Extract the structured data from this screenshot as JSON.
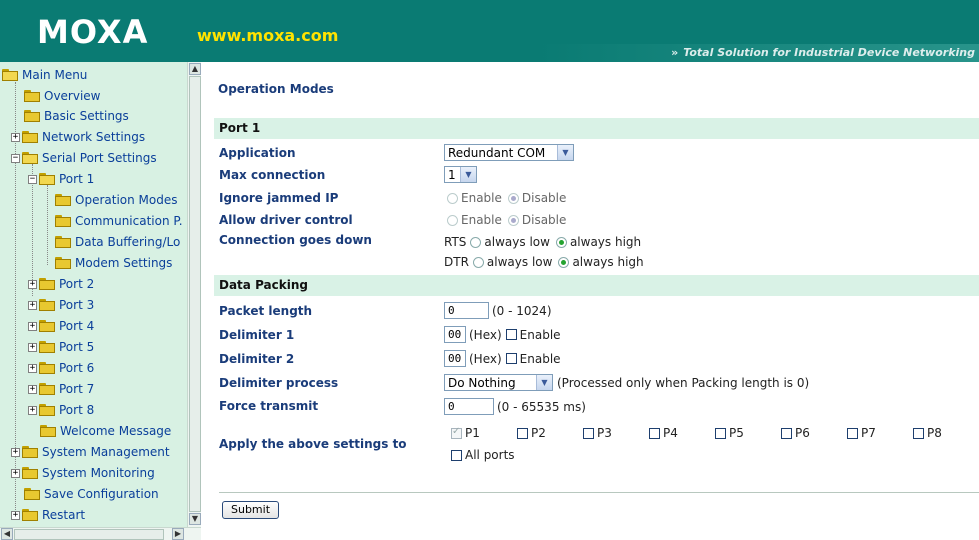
{
  "header": {
    "logo": "MOXA",
    "url": "www.moxa.com",
    "tagline": "Total Solution for Industrial Device Networking"
  },
  "sidebar": {
    "items": [
      {
        "label": "Main Menu"
      },
      {
        "label": "Overview"
      },
      {
        "label": "Basic Settings"
      },
      {
        "label": "Network Settings"
      },
      {
        "label": "Serial Port Settings"
      },
      {
        "label": "Port 1"
      },
      {
        "label": "Operation Modes"
      },
      {
        "label": "Communication P."
      },
      {
        "label": "Data Buffering/Lo"
      },
      {
        "label": "Modem Settings"
      },
      {
        "label": "Port 2"
      },
      {
        "label": "Port 3"
      },
      {
        "label": "Port 4"
      },
      {
        "label": "Port 5"
      },
      {
        "label": "Port 6"
      },
      {
        "label": "Port 7"
      },
      {
        "label": "Port 8"
      },
      {
        "label": "Welcome Message"
      },
      {
        "label": "System Management"
      },
      {
        "label": "System Monitoring"
      },
      {
        "label": "Save Configuration"
      },
      {
        "label": "Restart"
      }
    ]
  },
  "main": {
    "title": "Operation Modes",
    "port_section": "Port 1",
    "application": {
      "label": "Application",
      "value": "Redundant COM"
    },
    "max_connection": {
      "label": "Max connection",
      "value": "1"
    },
    "ignore_jammed": {
      "label": "Ignore jammed IP",
      "enable": "Enable",
      "disable": "Disable",
      "selected": "Disable"
    },
    "allow_driver": {
      "label": "Allow driver control",
      "enable": "Enable",
      "disable": "Disable",
      "selected": "Disable"
    },
    "conn_down": {
      "label": "Connection goes down",
      "rts": "RTS",
      "dtr": "DTR",
      "low": "always low",
      "high": "always high",
      "rts_selected": "always high",
      "dtr_selected": "always high"
    },
    "data_packing_section": "Data Packing",
    "packet_length": {
      "label": "Packet length",
      "value": "0",
      "hint": "(0 - 1024)"
    },
    "delimiter1": {
      "label": "Delimiter 1",
      "value": "00",
      "hex": "(Hex)",
      "enable": "Enable",
      "checked": false
    },
    "delimiter2": {
      "label": "Delimiter 2",
      "value": "00",
      "hex": "(Hex)",
      "enable": "Enable",
      "checked": false
    },
    "delimiter_process": {
      "label": "Delimiter process",
      "value": "Do Nothing",
      "hint": "(Processed only when Packing length is 0)"
    },
    "force_transmit": {
      "label": "Force transmit",
      "value": "0",
      "hint": "(0 - 65535 ms)"
    },
    "apply": {
      "label": "Apply the above settings to",
      "ports": [
        {
          "label": "P1",
          "checked": true
        },
        {
          "label": "P2",
          "checked": false
        },
        {
          "label": "P3",
          "checked": false
        },
        {
          "label": "P4",
          "checked": false
        },
        {
          "label": "P5",
          "checked": false
        },
        {
          "label": "P6",
          "checked": false
        },
        {
          "label": "P7",
          "checked": false
        },
        {
          "label": "P8",
          "checked": false
        }
      ],
      "all_ports": "All ports"
    },
    "submit": "Submit"
  }
}
